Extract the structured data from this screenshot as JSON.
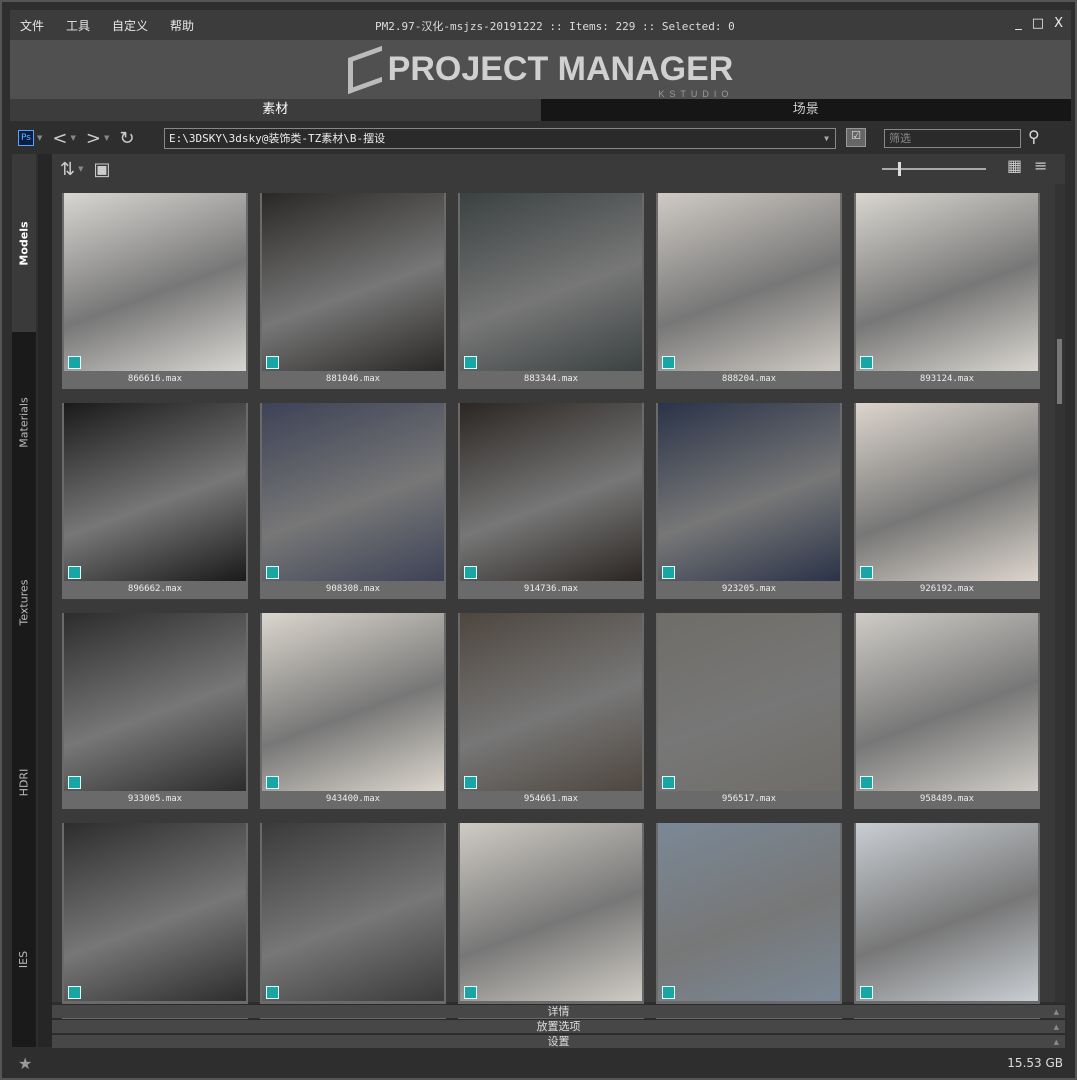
{
  "menu": [
    "文件",
    "工具",
    "自定义",
    "帮助"
  ],
  "title": "PM2.97-汉化-msjzs-20191222  :: Items: 229  :: Selected: 0",
  "window_controls": {
    "minimize": "_",
    "maximize": "□",
    "close": "X"
  },
  "logo": {
    "text": "PROJECT MANAGER",
    "sub": "KSTUDIO"
  },
  "tabs": [
    {
      "label": "素材",
      "active": true
    },
    {
      "label": "场景",
      "active": false
    }
  ],
  "toolbar": {
    "ps": "Ps",
    "path": "E:\\3DSKY\\3dsky@装饰类-TZ素材\\B-摆设",
    "filter_placeholder": "筛选"
  },
  "side_tabs": [
    "Models",
    "Materials",
    "Textures",
    "HDRI",
    "IES"
  ],
  "items": [
    {
      "name": "866616.max",
      "tone": "#d8d6d2"
    },
    {
      "name": "881046.max",
      "tone": "#2a2826"
    },
    {
      "name": "883344.max",
      "tone": "#3b4142"
    },
    {
      "name": "888204.max",
      "tone": "#cfcac4"
    },
    {
      "name": "893124.max",
      "tone": "#d9d6d0"
    },
    {
      "name": "896662.max",
      "tone": "#1a1a1a"
    },
    {
      "name": "908308.max",
      "tone": "#3d4256"
    },
    {
      "name": "914736.max",
      "tone": "#2b2623"
    },
    {
      "name": "923205.max",
      "tone": "#2a3348"
    },
    {
      "name": "926192.max",
      "tone": "#dcd5cc"
    },
    {
      "name": "933005.max",
      "tone": "#2c2c2c"
    },
    {
      "name": "943400.max",
      "tone": "#dbd6cd"
    },
    {
      "name": "954661.max",
      "tone": "#4e463f"
    },
    {
      "name": "956517.max",
      "tone": "#6f6d68"
    },
    {
      "name": "958489.max",
      "tone": "#cfccc7"
    },
    {
      "name": "",
      "tone": "#2d2d2d"
    },
    {
      "name": "",
      "tone": "#3a3a3a"
    },
    {
      "name": "",
      "tone": "#cfcbc4"
    },
    {
      "name": "",
      "tone": "#7a8896"
    },
    {
      "name": "",
      "tone": "#c9ced3"
    }
  ],
  "panels": [
    "详情",
    "放置选项",
    "设置"
  ],
  "status": {
    "disk": "15.53 GB"
  }
}
